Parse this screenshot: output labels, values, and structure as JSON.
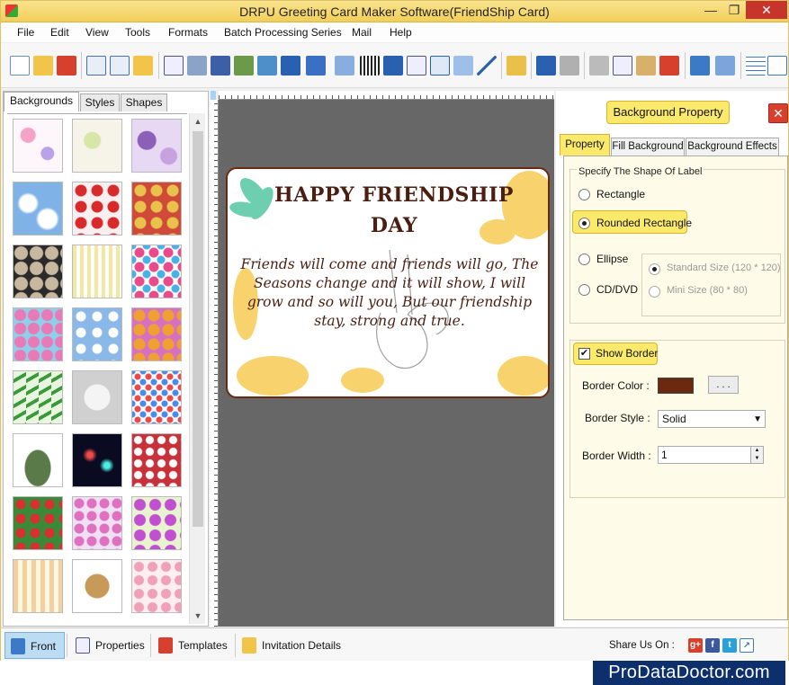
{
  "window": {
    "title": "DRPU Greeting Card Maker Software(FriendShip Card)",
    "min_glyph": "—",
    "max_glyph": "❐",
    "close_glyph": "✕"
  },
  "menu": [
    "File",
    "Edit",
    "View",
    "Tools",
    "Formats",
    "Batch Processing Series",
    "Mail",
    "Help"
  ],
  "left_panel": {
    "tabs": [
      "Backgrounds",
      "Styles",
      "Shapes"
    ],
    "active_tab": "Backgrounds"
  },
  "card": {
    "title_line1": "HAPPY FRIENDSHIP",
    "title_line2": "DAY",
    "verse": "Friends will come and friends will go, The Seasons change and it will show, I will grow and so will you, But our friendship stay, strong and true."
  },
  "right_panel": {
    "heading": "Background Property",
    "tabs": [
      "Property",
      "Fill Background",
      "Background Effects"
    ],
    "active_tab": "Property",
    "shape_group_label": "Specify The Shape Of Label",
    "shapes": {
      "rectangle": "Rectangle",
      "rounded_rectangle": "Rounded Rectangle",
      "ellipse": "Ellipse",
      "cd_dvd": "CD/DVD"
    },
    "selected_shape": "Rounded Rectangle",
    "sizes": {
      "standard": "Standard Size (120 * 120)",
      "mini": "Mini Size (80 * 80)"
    },
    "show_border_label": "Show Border",
    "show_border_checked": "✔",
    "border_color_label": "Border Color :",
    "border_color": "#6b2a10",
    "dots_label": ". . .",
    "border_style_label": "Border Style :",
    "border_style_value": "Solid",
    "border_width_label": "Border Width :",
    "border_width_value": "1"
  },
  "bottom_bar": {
    "front": "Front",
    "properties": "Properties",
    "templates": "Templates",
    "invitation": "Invitation Details",
    "share_label": "Share Us On :"
  },
  "brand": "ProDataDoctor.com",
  "colors": {
    "title_bar": "#f2cf5a",
    "highlight": "#fae96a",
    "canvas_bg": "#676767",
    "card_text": "#4a1e10",
    "brand_bg": "#0d2f6b"
  }
}
